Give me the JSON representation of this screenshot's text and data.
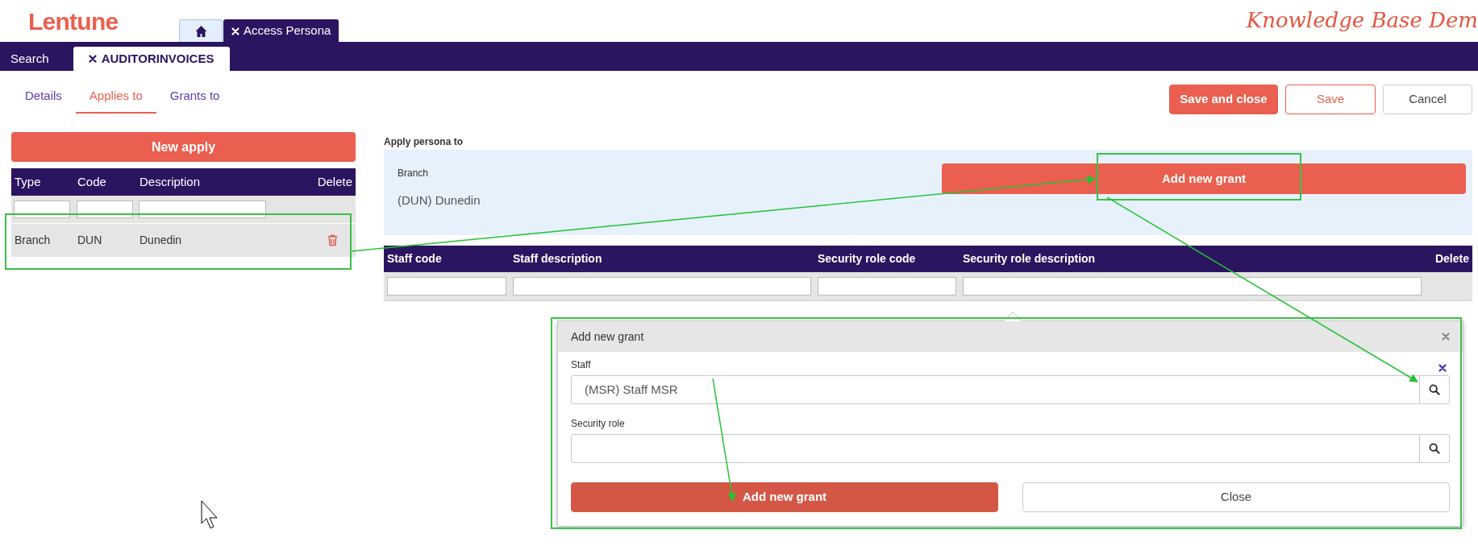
{
  "header": {
    "logo": "Lentune",
    "tagline": "Knowledge Base Dem"
  },
  "app_tabs": [
    {
      "kind": "home",
      "selected": false
    },
    {
      "kind": "page",
      "label": "Access Persona",
      "selected": true
    }
  ],
  "nav_tabs": [
    {
      "label": "Search",
      "closable": false,
      "selected": false
    },
    {
      "label": "AUDITORINVOICES",
      "closable": true,
      "selected": true
    }
  ],
  "sub_tabs": [
    {
      "label": "Details",
      "selected": false
    },
    {
      "label": "Applies to",
      "selected": true
    },
    {
      "label": "Grants to",
      "selected": false
    }
  ],
  "actions": [
    {
      "label": "Save and close",
      "kind": "primary"
    },
    {
      "label": "Save",
      "kind": "outline"
    },
    {
      "label": "Cancel",
      "kind": "plain"
    }
  ],
  "applies": {
    "new_button": "New apply",
    "columns": [
      "Type",
      "Code",
      "Description",
      "Delete"
    ],
    "rows": [
      {
        "type": "Branch",
        "code": "DUN",
        "description": "Dunedin",
        "selected": true
      }
    ]
  },
  "apply_panel": {
    "title": "Apply persona to",
    "field_label": "Branch",
    "value": "(DUN) Dunedin",
    "button": "Add new grant"
  },
  "grants_table": {
    "columns": [
      "Staff code",
      "Staff description",
      "Security role code",
      "Security role description",
      "Delete"
    ]
  },
  "dialog": {
    "title": "Add new grant",
    "fields": [
      {
        "label": "Staff",
        "value": "(MSR) Staff MSR"
      },
      {
        "label": "Security role"
      }
    ],
    "buttons": [
      {
        "label": "Add new grant",
        "kind": "primary"
      },
      {
        "label": "Close",
        "kind": "plain"
      }
    ]
  }
}
